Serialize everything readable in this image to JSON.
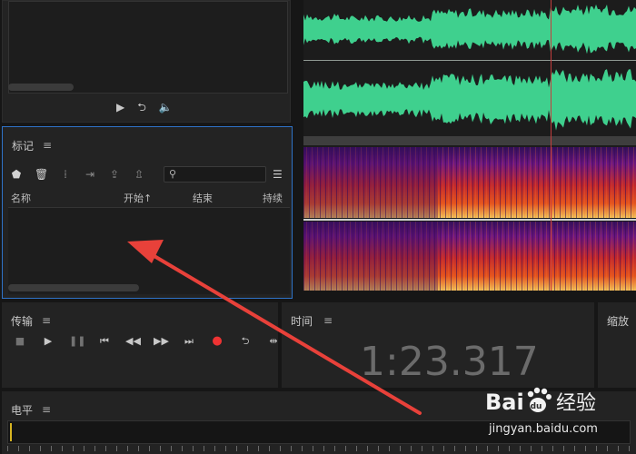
{
  "colors": {
    "waveform": "#3fd08e",
    "selection_border": "#2f73c8",
    "record": "#e33333",
    "playhead": "#c43d3d",
    "annotation_arrow": "#e8413a"
  },
  "media_panel": {
    "controls": [
      {
        "icon": "play-icon",
        "glyph": "▶"
      },
      {
        "icon": "loop-icon",
        "glyph": "⮌"
      },
      {
        "icon": "volume-icon",
        "glyph": "🔈"
      }
    ]
  },
  "markers_panel": {
    "title": "标记",
    "menu_glyph": "≡",
    "toolbar": [
      {
        "icon": "marker-icon",
        "glyph": "⬟",
        "enabled": true
      },
      {
        "icon": "trash-icon",
        "glyph": "🗑",
        "enabled": true
      },
      {
        "icon": "merge-icon",
        "glyph": "⁞",
        "enabled": false
      },
      {
        "icon": "insert-playlist-icon",
        "glyph": "⇥",
        "enabled": false
      },
      {
        "icon": "export-range-icon",
        "glyph": "⇪",
        "enabled": false
      },
      {
        "icon": "batch-icon",
        "glyph": "⇫",
        "enabled": false
      }
    ],
    "search": {
      "placeholder": "",
      "glyph": "⚲"
    },
    "list_glyph": "☰",
    "columns": [
      "名称",
      "开始",
      "结束",
      "持续时"
    ],
    "sort_glyph": "↑"
  },
  "transport_panel": {
    "title": "传输",
    "menu_glyph": "≡",
    "buttons": [
      {
        "icon": "stop-icon",
        "glyph": "■",
        "dim": true
      },
      {
        "icon": "play-icon",
        "glyph": "▶",
        "dim": false
      },
      {
        "icon": "pause-icon",
        "glyph": "❚❚",
        "dim": true
      },
      {
        "icon": "skip-back-icon",
        "glyph": "⏮",
        "dim": false
      },
      {
        "icon": "rewind-icon",
        "glyph": "◀◀",
        "dim": false
      },
      {
        "icon": "fast-forward-icon",
        "glyph": "▶▶",
        "dim": false
      },
      {
        "icon": "skip-forward-icon",
        "glyph": "⏭",
        "dim": false
      },
      {
        "icon": "record-icon",
        "glyph": "●",
        "dim": false
      },
      {
        "icon": "loop-icon",
        "glyph": "⮌",
        "dim": false
      },
      {
        "icon": "skip-silence-icon",
        "glyph": "⇹",
        "dim": false
      }
    ]
  },
  "time_panel": {
    "title": "时间",
    "menu_glyph": "≡",
    "current_time": "1:23.317"
  },
  "zoom_panel": {
    "title": "缩放"
  },
  "level_panel": {
    "title": "电平",
    "menu_glyph": "≡"
  },
  "watermark": {
    "brand": "Bai du 经验",
    "url": "jingyan.baidu.com"
  }
}
